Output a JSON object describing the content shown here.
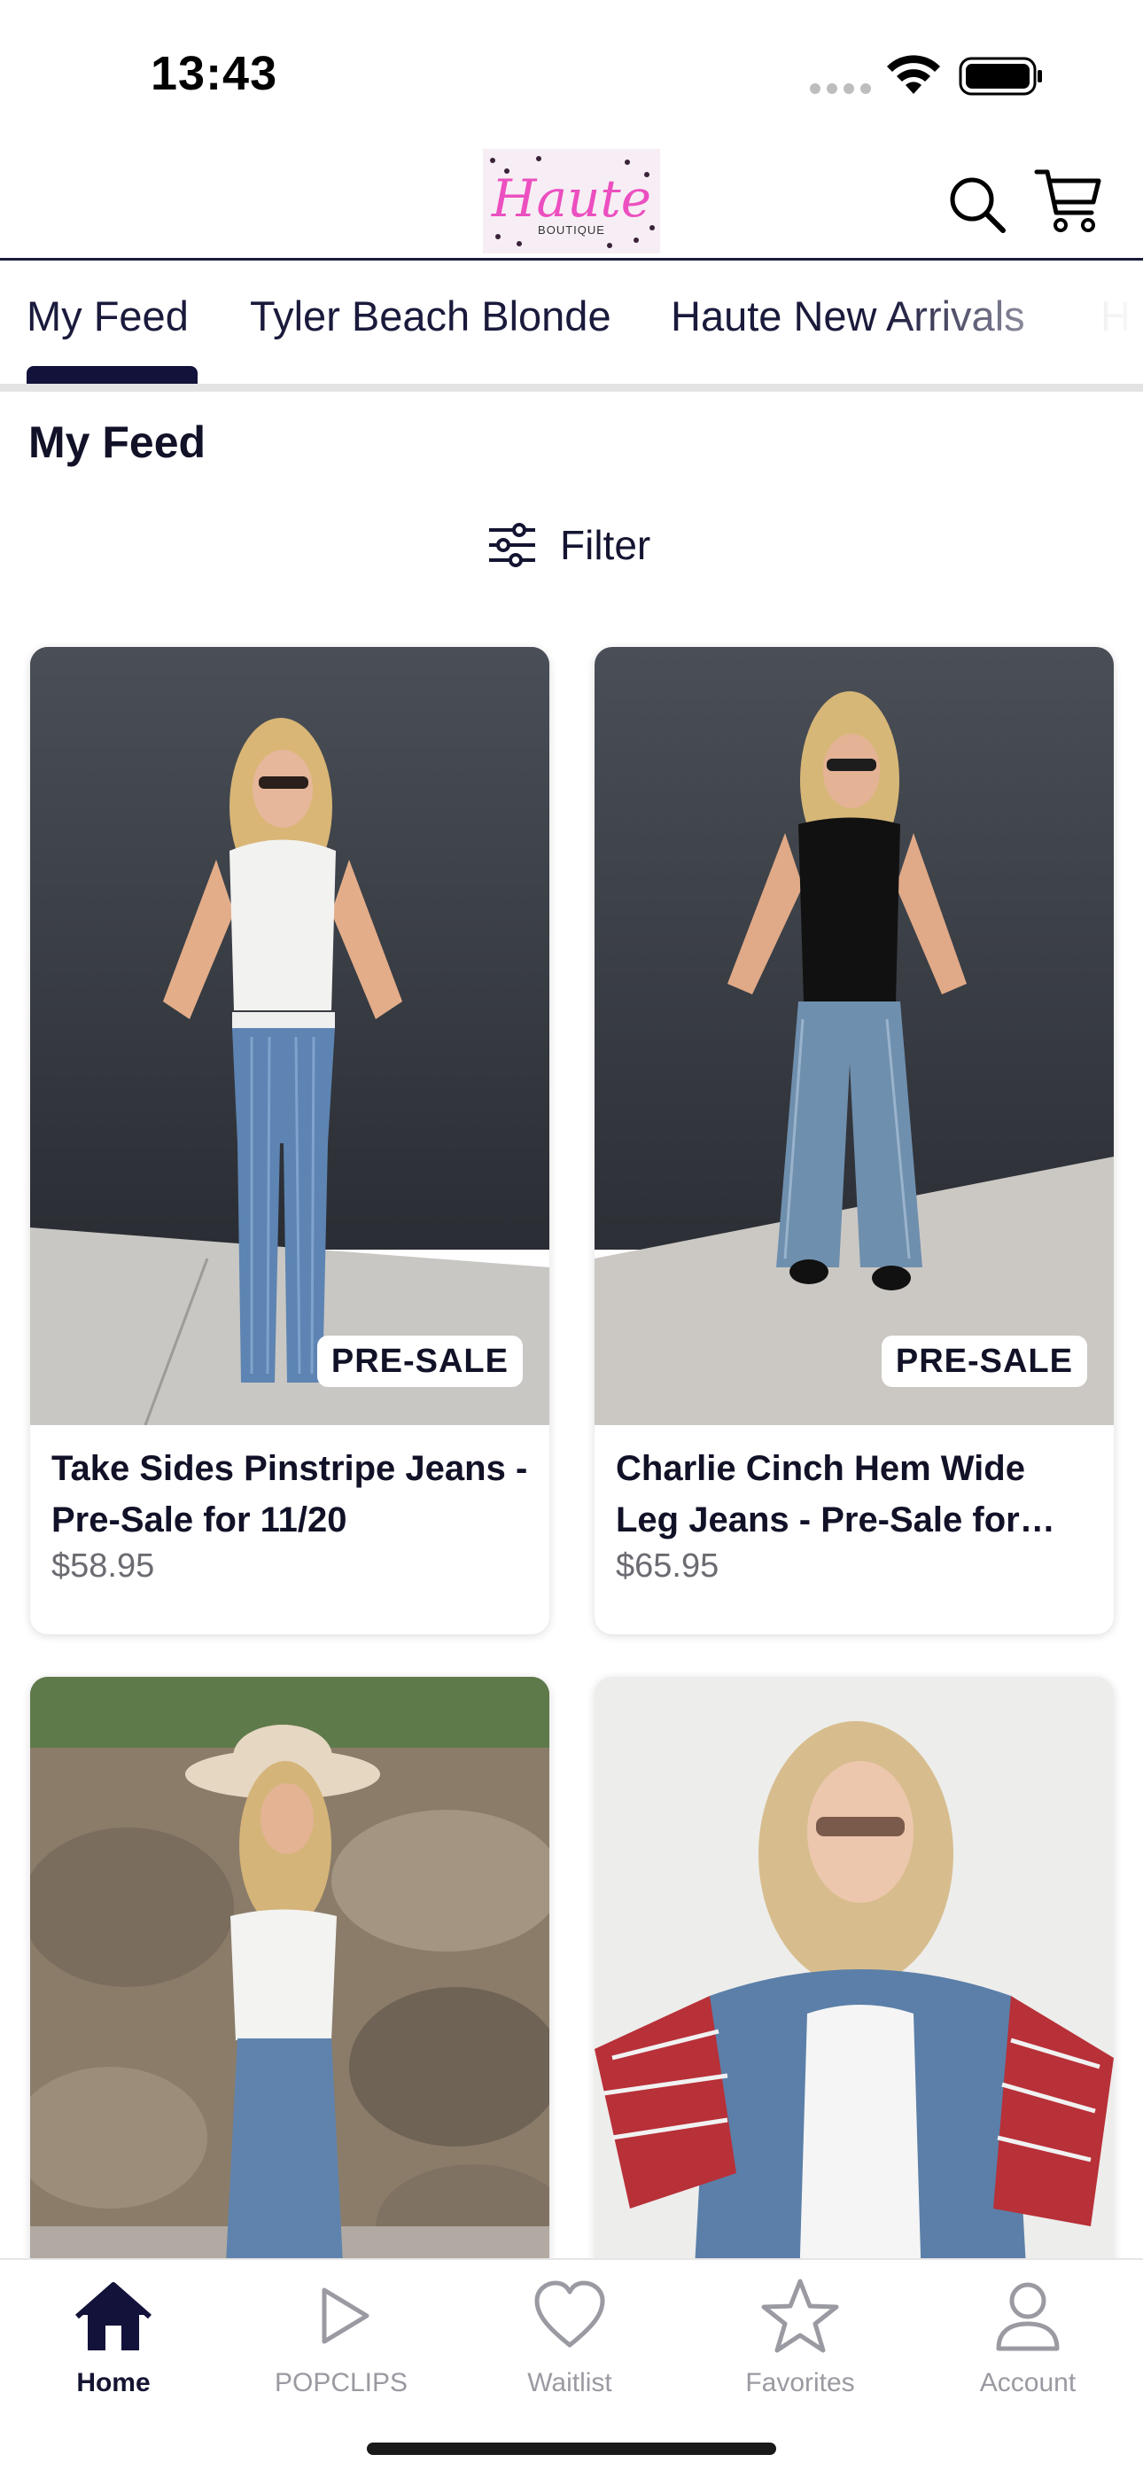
{
  "status_bar": {
    "time": "13:43"
  },
  "header": {
    "logo_text": "Haute",
    "logo_subtext": "BOUTIQUE",
    "search_icon": "search-icon",
    "cart_icon": "cart-icon"
  },
  "tabs": [
    {
      "label": "My Feed",
      "active": true
    },
    {
      "label": "Tyler Beach Blonde",
      "active": false
    },
    {
      "label": "Haute New Arrivals",
      "active": false
    },
    {
      "label": "H",
      "active": false
    }
  ],
  "section_title": "My Feed",
  "filter": {
    "label": "Filter",
    "icon": "sliders-icon"
  },
  "products": [
    {
      "title": "Take Sides Pinstripe Jeans - Pre-Sale for 11/20",
      "price": "$58.95",
      "badge": "PRE-SALE"
    },
    {
      "title": "Charlie Cinch Hem Wide Leg Jeans - Pre-Sale for…",
      "price": "$65.95",
      "badge": "PRE-SALE"
    },
    {
      "title": "",
      "price": "",
      "badge": ""
    },
    {
      "title": "",
      "price": "",
      "badge": ""
    }
  ],
  "tabbar": [
    {
      "label": "Home",
      "icon": "home-icon",
      "active": true
    },
    {
      "label": "POPCLIPS",
      "icon": "play-icon",
      "active": false
    },
    {
      "label": "Waitlist",
      "icon": "heart-icon",
      "active": false
    },
    {
      "label": "Favorites",
      "icon": "star-icon",
      "active": false
    },
    {
      "label": "Account",
      "icon": "person-icon",
      "active": false
    }
  ],
  "colors": {
    "brand_navy": "#12123a",
    "logo_pink": "#ec4fc0",
    "muted_gray": "#9a9aa2"
  }
}
